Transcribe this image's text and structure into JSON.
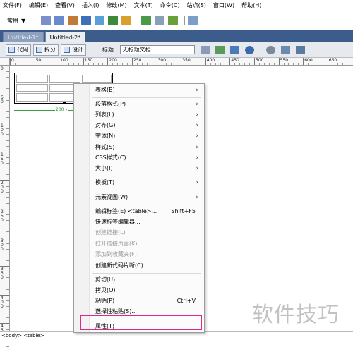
{
  "menubar": {
    "items": [
      "文件(F)",
      "编辑(E)",
      "查看(V)",
      "插入(I)",
      "修改(M)",
      "文本(T)",
      "命令(C)",
      "站点(S)",
      "窗口(W)",
      "帮助(H)"
    ]
  },
  "insertbar": {
    "category": "常用",
    "icons": [
      "hyperlink-icon",
      "email-link-icon",
      "anchor-icon",
      "table-icon",
      "div-icon",
      "image-icon",
      "media-icon",
      "date-icon",
      "comment-icon",
      "template-icon",
      "tag-chooser-icon"
    ]
  },
  "tabs": [
    {
      "label": "Untitled-1*",
      "active": false
    },
    {
      "label": "Untitled-2*",
      "active": true
    }
  ],
  "doctoolbar": {
    "code_label": "代码",
    "split_label": "拆分",
    "design_label": "设计",
    "title_label": "标题:",
    "title_value": "无标题文档"
  },
  "rulers": {
    "h_ticks": [
      "0",
      "50",
      "100",
      "150",
      "200",
      "250",
      "300",
      "350",
      "400",
      "450",
      "500",
      "550",
      "600",
      "650"
    ],
    "v_ticks": [
      "0",
      "50",
      "100",
      "150",
      "200",
      "250",
      "300",
      "350",
      "400",
      "450"
    ]
  },
  "table": {
    "width_label": "200 ▾"
  },
  "context_menu": {
    "items": [
      {
        "label": "表格(B)",
        "submenu": true
      },
      {
        "label": "段落格式(P)",
        "submenu": true
      },
      {
        "label": "列表(L)",
        "submenu": true
      },
      {
        "label": "对齐(G)",
        "submenu": true
      },
      {
        "label": "字体(N)",
        "submenu": true
      },
      {
        "label": "样式(S)",
        "submenu": true
      },
      {
        "label": "CSS样式(C)",
        "submenu": true
      },
      {
        "label": "大小(I)",
        "submenu": true
      },
      {
        "label": "模板(T)",
        "submenu": true
      },
      {
        "label": "元素视图(W)",
        "submenu": true
      },
      {
        "label": "编辑标签(E) <table>...",
        "shortcut": "Shift+F5"
      },
      {
        "label": "快速标签编辑器..."
      },
      {
        "label": "创建链接(L)",
        "disabled": true
      },
      {
        "label": "打开链接页面(K)",
        "disabled": true
      },
      {
        "label": "添加到收藏夹(F)",
        "disabled": true
      },
      {
        "label": "创建新代码片断(C)"
      },
      {
        "label": "剪切(U)"
      },
      {
        "label": "拷贝(O)"
      },
      {
        "label": "粘贴(P)",
        "shortcut": "Ctrl+V"
      },
      {
        "label": "选择性粘贴(S)..."
      },
      {
        "label": "属性(T)"
      }
    ]
  },
  "statusbar": {
    "tag_path": "<body> <table>"
  },
  "watermark": "软件技巧",
  "colors": {
    "tab_bar": "#3c5c8c",
    "highlight": "#e0278a",
    "table_guide": "#3aa03a"
  }
}
